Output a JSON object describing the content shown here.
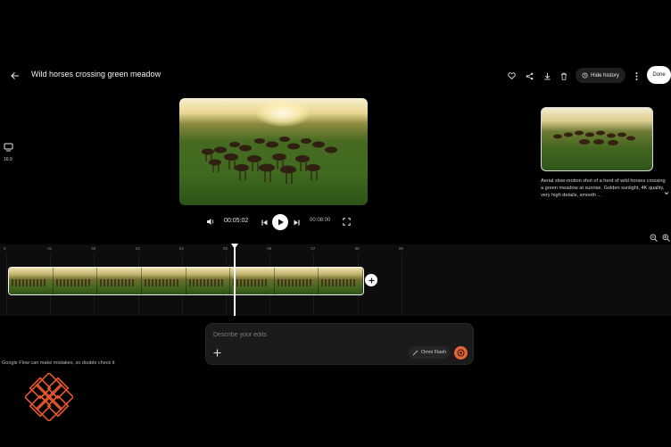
{
  "header": {
    "title": "Wild horses crossing green meadow",
    "hide_history_label": "Hide history",
    "done_label": "Done"
  },
  "aspect_ratio": {
    "label": "16:9"
  },
  "history": {
    "description": "Aerial slow-motion shot of a herd of wild horses crossing a green meadow at sunrise. Golden sunlight, 4K quality, very high details, smooth ..."
  },
  "playback": {
    "current_time": "00:05:02",
    "total_time": "00:08:00"
  },
  "timeline": {
    "ticks": [
      "0",
      "01",
      "02",
      "03",
      "04",
      "05",
      "06",
      "07",
      "08",
      "09"
    ],
    "clip_frames": 8,
    "playhead_second": 5.2
  },
  "prompt": {
    "placeholder": "Describe your edits",
    "model_label": "Omni Flash"
  },
  "disclaimer": "Google Flow can make mistakes, so double check it",
  "colors": {
    "background": "#000000",
    "accent": "#e0643a",
    "logo": "#e8572e"
  },
  "icons": {
    "back": "arrow-left-icon",
    "favorite": "heart-icon",
    "share": "share-icon",
    "download": "download-icon",
    "delete": "trash-icon",
    "history": "history-icon",
    "more": "more-vert-icon",
    "volume": "volume-icon",
    "skip_previous": "skip-previous-icon",
    "play": "play-icon",
    "skip_next": "skip-next-icon",
    "fullscreen": "fullscreen-icon",
    "zoom_out": "zoom-out-icon",
    "zoom_in": "zoom-in-icon",
    "add": "plus-icon",
    "model": "wand-icon",
    "send": "send-icon",
    "aspect": "aspect-ratio-icon"
  }
}
